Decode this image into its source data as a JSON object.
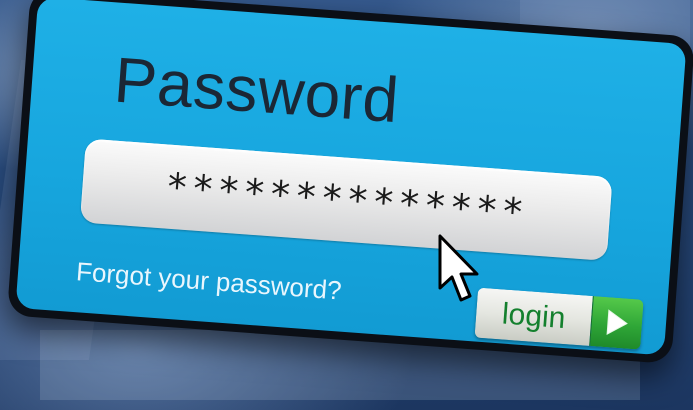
{
  "login_form": {
    "title": "Password",
    "password_value": "**************",
    "forgot_link": "Forgot your password?",
    "login_label": "login"
  },
  "colors": {
    "panel_blue": "#1fb0e6",
    "panel_border": "#0b0f16",
    "login_text_green": "#14802e",
    "arrow_green": "#2fa637"
  },
  "icons": {
    "play": "play-arrow-icon",
    "pointer": "mouse-pointer-icon"
  }
}
